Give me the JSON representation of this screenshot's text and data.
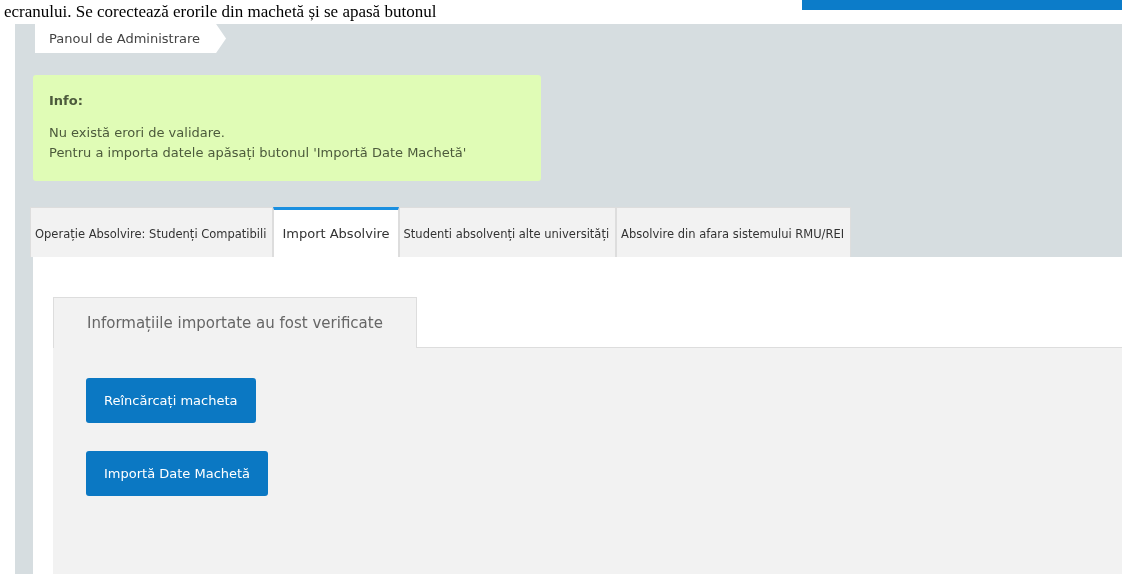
{
  "document_text": "ecranului. Se corectează erorile din machetă și se apasă butonul",
  "breadcrumb": "Panoul de Administrare",
  "info": {
    "title": "Info:",
    "lines": [
      "Nu există erori de validare.",
      "Pentru a importa datele apăsați butonul 'Importă Date Machetă'"
    ]
  },
  "tabs": [
    {
      "label": "Operație Absolvire: Studenți Compatibili",
      "selected": false
    },
    {
      "label": "Import Absolvire",
      "selected": true
    },
    {
      "label": "Studenti absolvenți alte universități",
      "selected": false
    },
    {
      "label": "Absolvire din afara sistemului RMU/REI",
      "selected": false
    }
  ],
  "panel": {
    "tab": "Informațiile importate au fost verificate",
    "buttons": [
      "Reîncărcați macheta",
      "Importă Date Machetă"
    ]
  }
}
